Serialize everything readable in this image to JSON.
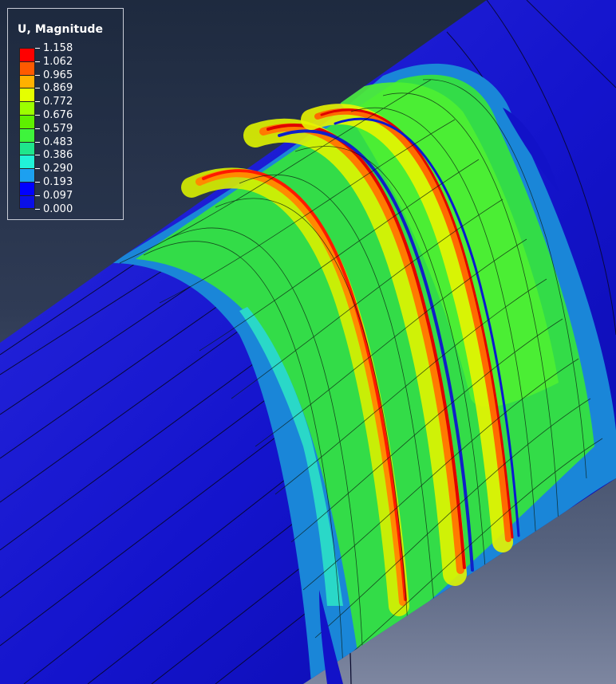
{
  "legend": {
    "title": "U, Magnitude",
    "levels": [
      "1.158",
      "1.062",
      "0.965",
      "0.869",
      "0.772",
      "0.676",
      "0.579",
      "0.483",
      "0.386",
      "0.290",
      "0.193",
      "0.097",
      "0.000"
    ],
    "colors": [
      "#ff0000",
      "#ff5a00",
      "#ffb100",
      "#e5ff00",
      "#9cff00",
      "#5ef000",
      "#3ef43c",
      "#1fe68c",
      "#21f2d8",
      "#1ca0f0",
      "#0000ff",
      "#0a10e6"
    ]
  },
  "model": {
    "shaft_color": "#1515d2",
    "mesh_color": "#0a0a28",
    "hot_color": "#ff0000"
  }
}
